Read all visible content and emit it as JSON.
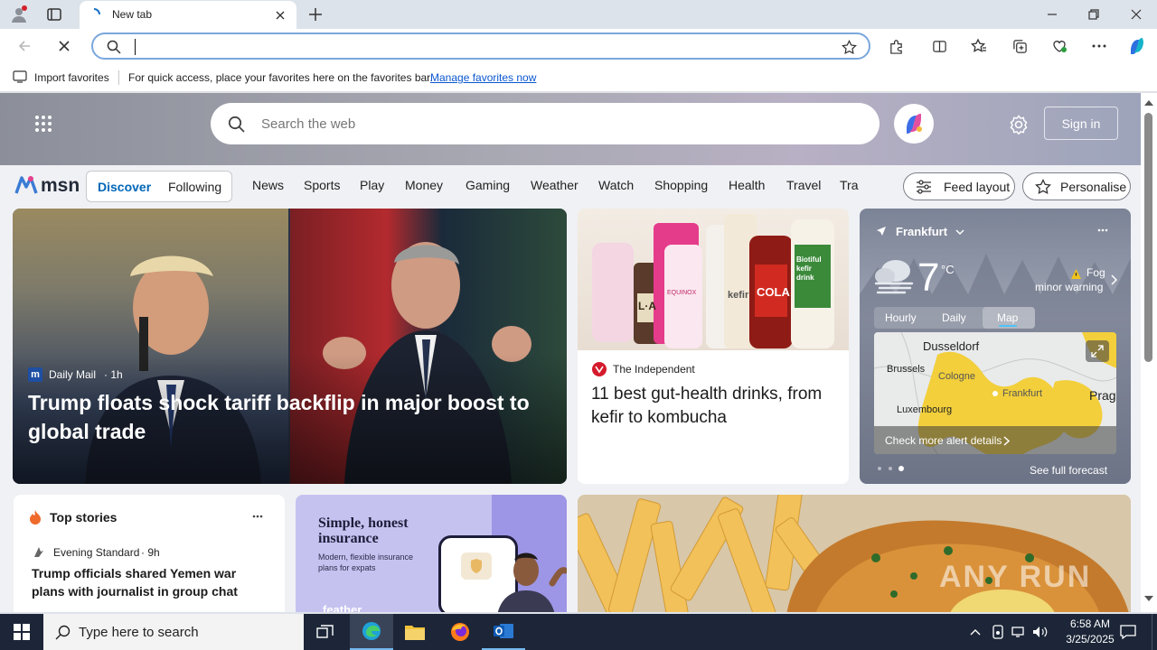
{
  "browser": {
    "tab_title": "New tab",
    "address_value": "",
    "fav_import": "Import favorites",
    "fav_message": "For quick access, place your favorites here on the favorites bar.",
    "fav_manage": "Manage favorites now"
  },
  "msn": {
    "search_placeholder": "Search the web",
    "sign_in": "Sign in",
    "logo": "msn",
    "tabs": [
      "Discover",
      "Following"
    ],
    "nav": [
      "News",
      "Sports",
      "Play",
      "Money",
      "Gaming",
      "Weather",
      "Watch",
      "Shopping",
      "Health",
      "Travel",
      "Tra"
    ],
    "feed_layout": "Feed layout",
    "personalise": "Personalise"
  },
  "hero_story": {
    "source": "Daily Mail",
    "age": "· 1h",
    "headline": "Trump floats shock tariff backflip in major boost to global trade"
  },
  "independent": {
    "source": "The Independent",
    "headline": "11 best gut-health drinks, from kefir to kombucha",
    "product_labels": [
      "L·A",
      "EQUINOX",
      "kefir",
      "COLA",
      "Biotiful kefir drink"
    ]
  },
  "weather": {
    "city": "Frankfurt",
    "temp": "7",
    "unit": "°C",
    "condition": "Fog",
    "warning": "minor warning",
    "tabs": [
      "Hourly",
      "Daily",
      "Map"
    ],
    "map_labels": [
      "Dusseldorf",
      "Brussels",
      "Cologne",
      "Frankfurt",
      "Luxembourg",
      "Prag"
    ],
    "alert_link": "Check more alert details",
    "forecast_link": "See full forecast"
  },
  "top_stories": {
    "title": "Top stories",
    "source": "Evening Standard",
    "age": "· 9h",
    "headline": "Trump officials shared Yemen war plans with journalist in group chat"
  },
  "ad": {
    "title": "Simple, honest insurance",
    "body": "Modern, flexible insurance plans for expats",
    "brand": "feather"
  },
  "watermark": "ANY RUN",
  "taskbar": {
    "search_placeholder": "Type here to search",
    "time": "6:58 AM",
    "date": "3/25/2025"
  },
  "colors": {
    "accent": "#0067b8",
    "taskbar": "#1c2638",
    "address_border": "#7aa7dd"
  }
}
